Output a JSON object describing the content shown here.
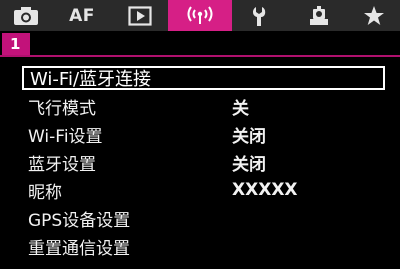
{
  "tabs": [
    {
      "name": "camera-tab",
      "icon": "camera-icon",
      "active": false
    },
    {
      "name": "af-tab",
      "label": "AF",
      "active": false
    },
    {
      "name": "playback-tab",
      "icon": "playback-icon",
      "active": false
    },
    {
      "name": "wireless-tab",
      "icon": "wireless-icon",
      "active": true
    },
    {
      "name": "setup-tab",
      "icon": "wrench-icon",
      "active": false
    },
    {
      "name": "custom-tab",
      "icon": "custom-functions-icon",
      "active": false
    },
    {
      "name": "mymenu-tab",
      "icon": "star-icon",
      "active": false
    }
  ],
  "page": {
    "number": "1"
  },
  "menu": {
    "items": [
      {
        "label": "Wi-Fi/蓝牙连接",
        "value": ""
      },
      {
        "label": "飞行模式",
        "value": "关"
      },
      {
        "label": "Wi-Fi设置",
        "value": "关闭"
      },
      {
        "label": "蓝牙设置",
        "value": "关闭"
      },
      {
        "label": "昵称",
        "value": "XXXXX"
      },
      {
        "label": "GPS设备设置",
        "value": ""
      },
      {
        "label": "重置通信设置",
        "value": ""
      }
    ]
  },
  "colors": {
    "accent": "#d61f86",
    "tabbar": "#2a2a2a",
    "background": "#000000"
  }
}
